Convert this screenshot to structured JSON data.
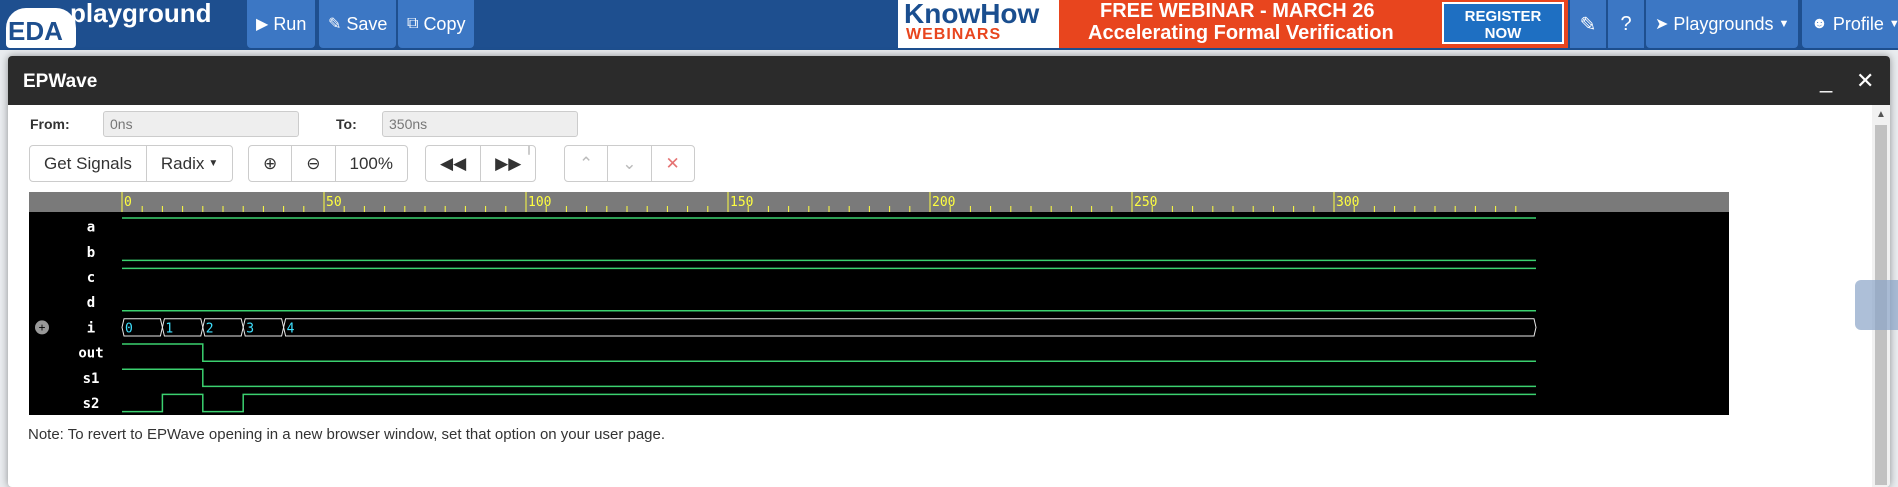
{
  "navbar": {
    "logo_eda": "EDA",
    "logo_playground": "playground",
    "run_label": "Run",
    "save_label": "Save",
    "copy_label": "Copy",
    "banner": {
      "knowhow": "KnowHow",
      "webinars": "WEBINARS",
      "line1": "FREE WEBINAR - MARCH 26",
      "line2": "Accelerating Formal Verification",
      "register_line1": "REGISTER",
      "register_line2": "NOW",
      "accent_color": "#e8451e"
    },
    "playgrounds_label": "Playgrounds",
    "profile_label": "Profile"
  },
  "modal": {
    "title": "EPWave",
    "from_label": "From:",
    "from_value": "0ns",
    "to_label": "To:",
    "to_value": "350ns",
    "toolbar": {
      "get_signals": "Get Signals",
      "radix": "Radix",
      "zoom_level": "100%"
    },
    "note": "Note: To revert to EPWave opening in a new browser window, set that option on your user page."
  },
  "waveform": {
    "ruler_ticks": [
      "0",
      "50",
      "100",
      "150",
      "200",
      "250",
      "300"
    ],
    "ruler_values": [
      0,
      50,
      100,
      150,
      200,
      250,
      300
    ],
    "signals": [
      {
        "name": "a",
        "type": "bit",
        "segments": [
          [
            0,
            350,
            1
          ]
        ]
      },
      {
        "name": "b",
        "type": "bit",
        "segments": [
          [
            0,
            350,
            0
          ]
        ]
      },
      {
        "name": "c",
        "type": "bit",
        "segments": [
          [
            0,
            350,
            1
          ]
        ]
      },
      {
        "name": "d",
        "type": "bit",
        "segments": [
          [
            0,
            350,
            0
          ]
        ]
      },
      {
        "name": "i",
        "type": "bus",
        "values": [
          {
            "t0": 0,
            "t1": 10,
            "v": "0"
          },
          {
            "t0": 10,
            "t1": 20,
            "v": "1"
          },
          {
            "t0": 20,
            "t1": 30,
            "v": "2"
          },
          {
            "t0": 30,
            "t1": 40,
            "v": "3"
          },
          {
            "t0": 40,
            "t1": 350,
            "v": "4"
          }
        ]
      },
      {
        "name": "out",
        "type": "bit",
        "segments": [
          [
            0,
            20,
            1
          ],
          [
            20,
            350,
            0
          ]
        ]
      },
      {
        "name": "s1",
        "type": "bit",
        "segments": [
          [
            0,
            20,
            1
          ],
          [
            20,
            350,
            0
          ]
        ]
      },
      {
        "name": "s2",
        "type": "bit",
        "segments": [
          [
            0,
            10,
            0
          ],
          [
            10,
            20,
            1
          ],
          [
            20,
            30,
            0
          ],
          [
            30,
            350,
            1
          ]
        ]
      }
    ],
    "colors": {
      "bit": "#3bd16f",
      "bus": "#e8e8e8",
      "bus_text": "#3fe0ff",
      "ruler": "#ffff40",
      "ruler_bg": "#7a7a7a"
    }
  }
}
